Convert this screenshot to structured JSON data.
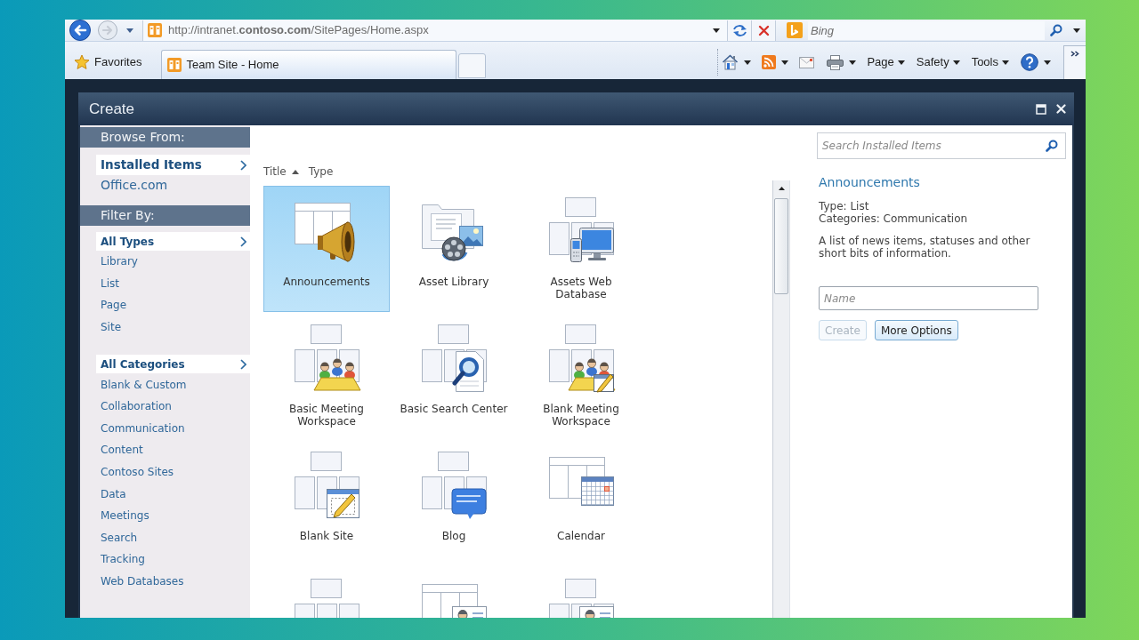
{
  "browser": {
    "address": "http://intranet.**contoso.com**/SitePages/Home.aspx",
    "search_placeholder": "Bing",
    "favorites": "Favorites",
    "tabs": [
      {
        "label": "Team Site - Home",
        "selected": true
      }
    ],
    "commands": [
      {
        "kind": "home",
        "dropdown": true
      },
      {
        "kind": "feeds",
        "dropdown": true
      },
      {
        "kind": "mail",
        "dropdown": false
      },
      {
        "kind": "print",
        "dropdown": true
      },
      {
        "kind": "menu",
        "label": "Page",
        "dropdown": true
      },
      {
        "kind": "menu",
        "label": "Safety",
        "dropdown": true
      },
      {
        "kind": "menu",
        "label": "Tools",
        "dropdown": true
      },
      {
        "kind": "help",
        "dropdown": true
      }
    ]
  },
  "dialog": {
    "title": "Create",
    "sidebar": [
      {
        "heading": "Browse From:",
        "groups": [
          {
            "items": [
              {
                "label": "Installed Items",
                "selected": true
              },
              {
                "label": "Office.com",
                "selected": false
              }
            ]
          }
        ]
      },
      {
        "heading": "Filter By:",
        "groups": [
          {
            "items": [
              {
                "label": "All Types",
                "selected": true
              },
              {
                "label": "Library",
                "selected": false
              },
              {
                "label": "List",
                "selected": false
              },
              {
                "label": "Page",
                "selected": false
              },
              {
                "label": "Site",
                "selected": false
              }
            ]
          },
          {
            "items": [
              {
                "label": "All Categories",
                "selected": true
              },
              {
                "label": "Blank & Custom",
                "selected": false
              },
              {
                "label": "Collaboration",
                "selected": false
              },
              {
                "label": "Communication",
                "selected": false
              },
              {
                "label": "Content",
                "selected": false
              },
              {
                "label": "Contoso Sites",
                "selected": false
              },
              {
                "label": "Data",
                "selected": false
              },
              {
                "label": "Meetings",
                "selected": false
              },
              {
                "label": "Search",
                "selected": false
              },
              {
                "label": "Tracking",
                "selected": false
              },
              {
                "label": "Web Databases",
                "selected": false
              }
            ]
          }
        ]
      }
    ],
    "sort": [
      {
        "label": "Title",
        "sorted": true
      },
      {
        "label": "Type",
        "sorted": false
      }
    ],
    "templates": [
      {
        "kind": "megaphone",
        "label": "Announcements",
        "selected": true
      },
      {
        "kind": "media",
        "label": "Asset Library",
        "selected": false
      },
      {
        "kind": "devices",
        "label": "Assets Web Database",
        "selected": false
      },
      {
        "kind": "meeting",
        "label": "Basic Meeting Workspace",
        "selected": false
      },
      {
        "kind": "search",
        "label": "Basic Search Center",
        "selected": false
      },
      {
        "kind": "meetingedit",
        "label": "Blank Meeting Workspace",
        "selected": false
      },
      {
        "kind": "pencil",
        "label": "Blank Site",
        "selected": false
      },
      {
        "kind": "speech",
        "label": "Blog",
        "selected": false
      },
      {
        "kind": "calendar",
        "label": "Calendar",
        "selected": false
      },
      {
        "kind": "tag",
        "selected": false
      },
      {
        "kind": "contact",
        "selected": false
      },
      {
        "kind": "card",
        "selected": false
      }
    ],
    "search": {
      "placeholder": "Search Installed Items"
    },
    "details": {
      "title": "Announcements",
      "type": "Type: List",
      "categories": "Categories: Communication",
      "description": "A list of news items, statuses and other short bits of information.",
      "name_placeholder": "Name",
      "buttons": [
        {
          "label": "Create",
          "disabled": true
        },
        {
          "label": "More Options",
          "disabled": false
        }
      ]
    }
  }
}
